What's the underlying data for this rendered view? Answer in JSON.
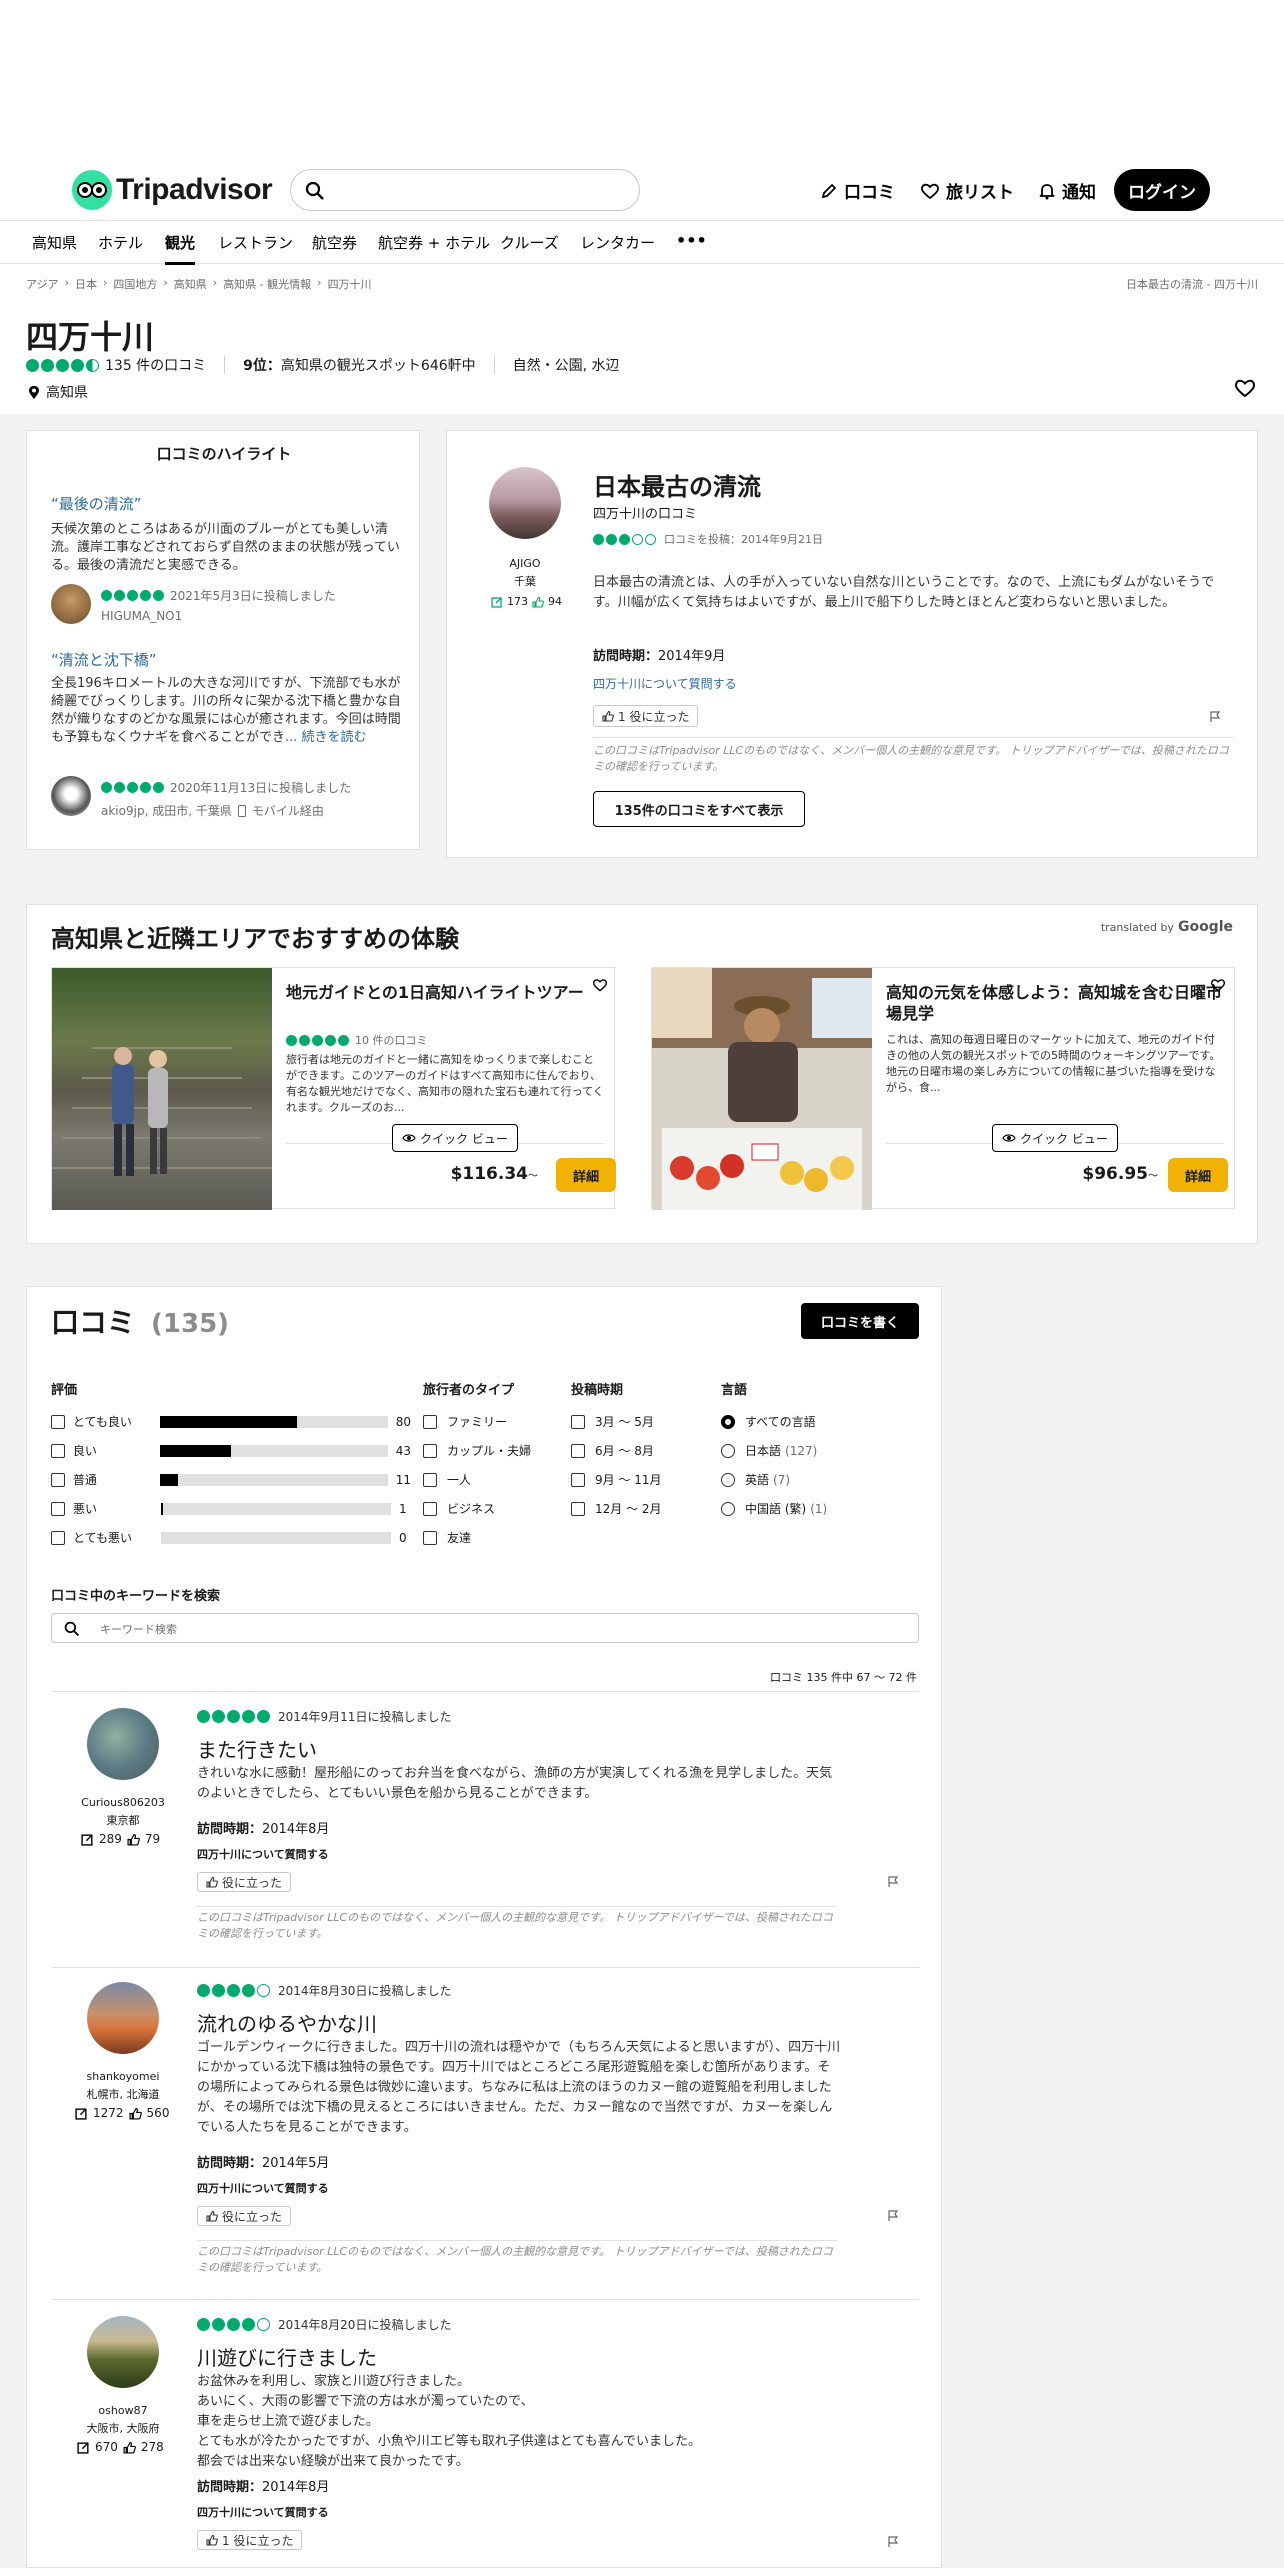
{
  "header": {
    "logo_text": "Tripadvisor",
    "search_placeholder": "",
    "review_label": "口コミ",
    "trips_label": "旅リスト",
    "alerts_label": "通知",
    "login_label": "ログイン"
  },
  "nav": {
    "items": [
      "高知県",
      "ホテル",
      "観光",
      "レストラン",
      "航空券",
      "航空券 + ホテル",
      "クルーズ",
      "レンタカー"
    ],
    "more": "•••"
  },
  "breadcrumb": {
    "items": [
      "アジア",
      "日本",
      "四国地方",
      "高知県",
      "高知県 - 観光情報",
      "四万十川"
    ],
    "right": "日本最古の清流 - 四万十川"
  },
  "attraction": {
    "name": "四万十川",
    "rating": 4.5,
    "review_count": "135 件の口コミ",
    "rank_bold": "9位：",
    "rank_text": "高知県の観光スポット646軒中",
    "categories": "自然・公園, 水辺",
    "location": "高知県"
  },
  "highlights": {
    "title": "口コミのハイライト",
    "items": [
      {
        "quote": "“最後の清流”",
        "text": "天候次第のところはあるが川面のブルーがとても美しい清流。護岸工事などされておらず自然のままの状態が残っている。最後の清流だと実感できる。",
        "rating": 5,
        "date": "2021年5月3日に投稿しました",
        "user": "HIGUMA_NO1",
        "more": ""
      },
      {
        "quote": "“清流と沈下橋”",
        "text": "全長196キロメートルの大きな河川ですが、下流部でも水が綺麗でびっくりします。川の所々に架かる沈下橋と豊かな自然が織りなすのどかな風景には心が癒されます。今回は時間も予算もなくウナギを食べることができ",
        "rating": 5,
        "date": "2020年11月13日に投稿しました",
        "user": "akio9jp, 成田市, 千葉県",
        "more": "... 続きを読む",
        "mobile": "モバイル経由"
      }
    ]
  },
  "featured": {
    "title": "日本最古の清流",
    "subtitle": "四万十川の口コミ",
    "rating": 3,
    "date": "口コミを投稿：2014年9月21日",
    "body": "日本最古の清流とは、人の手が入っていない自然な川ということです。なので、上流にもダムがないそうです。川幅が広くて気持ちはよいですが、最上川で船下りした時とほとんど変わらないと思いました。",
    "visit_label": "訪問時期：",
    "visit_value": "2014年9月",
    "question": "四万十川について質問する",
    "helpful": "1  役に立った",
    "disclaimer": "この口コミはTripadvisor LLCのものではなく、メンバー個人の主観的な意見です。 トリップアドバイザーでは、投稿されたロコミの確認を行っています。",
    "all_button": "135件の口コミをすべて表示",
    "user": {
      "name": "AJIGO",
      "location": "千葉",
      "contributions": "173",
      "helpful": "94"
    }
  },
  "experiences": {
    "title": "高知県と近隣エリアでおすすめの体験",
    "translated": "translated by",
    "google": "Google",
    "items": [
      {
        "title": "地元ガイドとの1日高知ハイライトツアー",
        "rating": 5,
        "reviews": "10 件の口コミ",
        "desc": "旅行者は地元のガイドと一緒に高知をゆっくりまで楽しむことができます。このツアーのガイドはすべて高知市に住んでおり、有名な観光地だけでなく、高知市の隠れた宝石も連れて行ってくれます。クルーズのお...",
        "quick": "クイック ビュー",
        "price": "$116.34",
        "price_suffix": "～",
        "details": "詳細"
      },
      {
        "title": "高知の元気を体感しよう：高知城を含む日曜市場見学",
        "rating": 0,
        "reviews": "",
        "desc": "これは、高知の毎週日曜日のマーケットに加えて、地元のガイド付きの他の人気の観光スポットでの5時間のウォーキングツアーです。地元の日曜市場の楽しみ方についての情報に基づいた指導を受けながら、食...",
        "quick": "クイック ビュー",
        "price": "$96.95",
        "price_suffix": "～",
        "details": "詳細"
      }
    ]
  },
  "reviews_section": {
    "title": "口コミ",
    "count": "(135)",
    "write_button": "口コミを書く",
    "filters": {
      "rating": {
        "title": "評価",
        "items": [
          {
            "label": "とても良い",
            "count": "80",
            "fill": 0.6
          },
          {
            "label": "良い",
            "count": "43",
            "fill": 0.31
          },
          {
            "label": "普通",
            "count": "11",
            "fill": 0.08
          },
          {
            "label": "悪い",
            "count": "1",
            "fill": 0.01
          },
          {
            "label": "とても悪い",
            "count": "0",
            "fill": 0.0
          }
        ]
      },
      "traveler": {
        "title": "旅行者のタイプ",
        "items": [
          "ファミリー",
          "カップル・夫婦",
          "一人",
          "ビジネス",
          "友達"
        ]
      },
      "period": {
        "title": "投稿時期",
        "items": [
          "3月 ～ 5月",
          "6月 ～ 8月",
          "9月 ～ 11月",
          "12月 ～ 2月"
        ]
      },
      "language": {
        "title": "言語",
        "items": [
          {
            "label": "すべての言語",
            "count": ""
          },
          {
            "label": "日本語",
            "count": "(127)"
          },
          {
            "label": "英語",
            "count": "(7)"
          },
          {
            "label": "中国語 (繁)",
            "count": "(1)"
          }
        ]
      }
    },
    "keyword_title": "口コミ中のキーワードを検索",
    "keyword_placeholder": "キーワード検索",
    "pagination": "口コミ 135 件中 67 ～ 72 件"
  },
  "reviews": [
    {
      "user": "Curious806203",
      "location": "東京都",
      "contributions": "289",
      "helpful": "79",
      "rating": 5,
      "date": "2014年9月11日に投稿しました",
      "title": "また行きたい",
      "body": "きれいな水に感動！屋形船にのってお弁当を食べながら、漁師の方が実演してくれる漁を見学しました。天気のよいときでしたら、とてもいい景色を船から見ることができます。",
      "visit_label": "訪問時期：",
      "visit_value": "2014年8月",
      "question": "四万十川について質問する",
      "helpful_btn": "役に立った",
      "disclaimer": "この口コミはTripadvisor LLCのものではなく、メンバー個人の主観的な意見です。 トリップアドバイザーでは、投稿されたロコミの確認を行っています。"
    },
    {
      "user": "shankoyomei",
      "location": "札幌市, 北海道",
      "contributions": "1272",
      "helpful": "560",
      "rating": 4,
      "date": "2014年8月30日に投稿しました",
      "title": "流れのゆるやかな川",
      "body": "ゴールデンウィークに行きました。四万十川の流れは穏やかで（もちろん天気によると思いますが）、四万十川にかかっている沈下橋は独特の景色です。四万十川ではところどころ尾形遊覧船を楽しむ箇所があります。その場所によってみられる景色は微妙に違います。ちなみに私は上流のほうのカヌー館の遊覧船を利用しましたが、その場所では沈下橋の見えるところにはいきません。ただ、カヌー館なので当然ですが、カヌーを楽しんでいる人たちを見ることができます。",
      "visit_label": "訪問時期：",
      "visit_value": "2014年5月",
      "question": "四万十川について質問する",
      "helpful_btn": "役に立った",
      "disclaimer": "この口コミはTripadvisor LLCのものではなく、メンバー個人の主観的な意見です。 トリップアドバイザーでは、投稿されたロコミの確認を行っています。"
    },
    {
      "user": "oshow87",
      "location": "大阪市, 大阪府",
      "contributions": "670",
      "helpful": "278",
      "rating": 4,
      "date": "2014年8月20日に投稿しました",
      "title": "川遊びに行きました",
      "body": "お盆休みを利用し、家族と川遊び行きました。\nあいにく、大雨の影響で下流の方は水が濁っていたので、\n車を走らせ上流で遊びました。\nとても水が冷たかったですが、小魚や川エビ等も取れ子供達はとても喜んでいました。\n都会では出来ない経験が出来て良かったです。",
      "visit_label": "訪問時期：",
      "visit_value": "2014年8月",
      "question": "四万十川について質問する",
      "helpful_btn": "1  役に立った",
      "disclaimer": ""
    }
  ]
}
